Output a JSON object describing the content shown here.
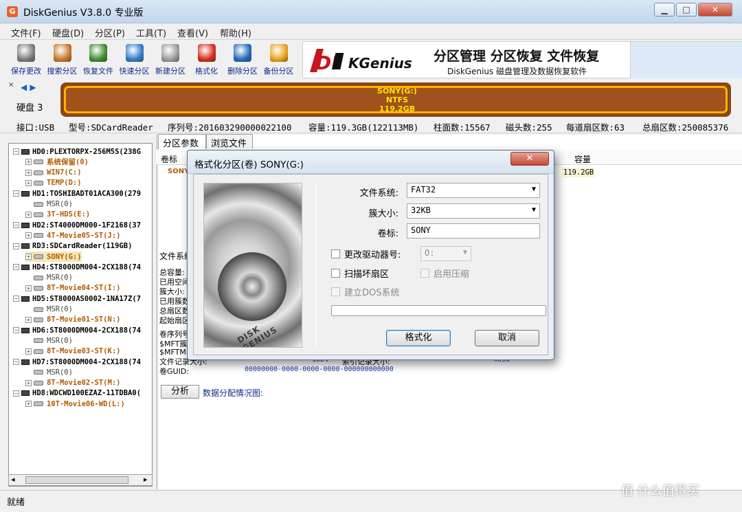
{
  "window": {
    "title": "DiskGenius V3.8.0 专业版",
    "app_icon_glyph": "G"
  },
  "menu": [
    "文件(F)",
    "硬盘(D)",
    "分区(P)",
    "工具(T)",
    "查看(V)",
    "帮助(H)"
  ],
  "toolbar": [
    {
      "label": "保存更改",
      "icon": "save-disk-icon",
      "color": "#7b7b7b"
    },
    {
      "label": "搜索分区",
      "icon": "magnifier-icon",
      "color": "#c9742c"
    },
    {
      "label": "恢复文件",
      "icon": "recover-box-icon",
      "color": "#3f8a2e"
    },
    {
      "label": "快速分区",
      "icon": "quick-partition-icon",
      "color": "#2f7cc8"
    },
    {
      "label": "新建分区",
      "icon": "new-partition-icon",
      "color": "#9a9a9a"
    },
    {
      "label": "格式化",
      "icon": "format-icon",
      "color": "#d42a1a"
    },
    {
      "label": "删除分区",
      "icon": "trash-icon",
      "color": "#1f69b8"
    },
    {
      "label": "备份分区",
      "icon": "backup-pie-icon",
      "color": "#e8a21a"
    }
  ],
  "banner": {
    "logo_text": "DISKGenius",
    "title": "分区管理 分区恢复 文件恢复",
    "subtitle": "DiskGenius 磁盘管理及数据恢复软件"
  },
  "disk_nav": {
    "label": "硬盘 3",
    "arrows": "◀ ▶",
    "pin": "×"
  },
  "disk_bar": {
    "name": "SONY(G:)",
    "fs": "NTFS",
    "size": "119.2GB"
  },
  "info_line": [
    "接口:USB",
    "型号:SDCardReader",
    "序列号:201603290000022100",
    "容量:119.3GB(122113MB)",
    "柱面数:15567",
    "磁头数:255",
    "每道扇区数:63",
    "总扇区数:250085376"
  ],
  "tree": [
    {
      "type": "disk",
      "text": "HD0:PLEXTORPX-256M5S(238G",
      "indent": 0,
      "exp": "−"
    },
    {
      "type": "part",
      "text": "系统保留(0)",
      "indent": 1,
      "exp": "+"
    },
    {
      "type": "part",
      "text": "WIN7(C:)",
      "indent": 1,
      "exp": "+"
    },
    {
      "type": "part",
      "text": "TEMP(D:)",
      "indent": 1,
      "exp": "+"
    },
    {
      "type": "disk",
      "text": "HD1:TOSHIBADT01ACA300(279",
      "indent": 0,
      "exp": "−"
    },
    {
      "type": "msr",
      "text": "MSR(0)",
      "indent": 1,
      "exp": ""
    },
    {
      "type": "part",
      "text": "3T-HDS(E:)",
      "indent": 1,
      "exp": "+"
    },
    {
      "type": "disk",
      "text": "HD2:ST4000DM000-1F2168(37",
      "indent": 0,
      "exp": "−"
    },
    {
      "type": "part",
      "text": "4T-Movie05-ST(J:)",
      "indent": 1,
      "exp": "+"
    },
    {
      "type": "disk",
      "text": "RD3:SDCardReader(119GB)",
      "indent": 0,
      "exp": "−"
    },
    {
      "type": "part",
      "text": "SONY(G:)",
      "indent": 1,
      "exp": "+",
      "selected": true
    },
    {
      "type": "disk",
      "text": "HD4:ST8000DM004-2CX188(74",
      "indent": 0,
      "exp": "−"
    },
    {
      "type": "msr",
      "text": "MSR(0)",
      "indent": 1,
      "exp": ""
    },
    {
      "type": "part",
      "text": "8T-Movie04-ST(I:)",
      "indent": 1,
      "exp": "+"
    },
    {
      "type": "disk",
      "text": "HD5:ST8000AS0002-1NA17Z(7",
      "indent": 0,
      "exp": "−"
    },
    {
      "type": "msr",
      "text": "MSR(0)",
      "indent": 1,
      "exp": ""
    },
    {
      "type": "part",
      "text": "8T-Movie01-ST(N:)",
      "indent": 1,
      "exp": "+"
    },
    {
      "type": "disk",
      "text": "HD6:ST8000DM004-2CX188(74",
      "indent": 0,
      "exp": "−"
    },
    {
      "type": "msr",
      "text": "MSR(0)",
      "indent": 1,
      "exp": ""
    },
    {
      "type": "part",
      "text": "8T-Movie03-ST(K:)",
      "indent": 1,
      "exp": "+"
    },
    {
      "type": "disk",
      "text": "HD7:ST8000DM004-2CX188(74",
      "indent": 0,
      "exp": "−"
    },
    {
      "type": "msr",
      "text": "MSR(0)",
      "indent": 1,
      "exp": ""
    },
    {
      "type": "part",
      "text": "8T-Movie02-ST(M:)",
      "indent": 1,
      "exp": "+"
    },
    {
      "type": "disk",
      "text": "HD8:WDCWD100EZAZ-11TDBA0(",
      "indent": 0,
      "exp": "−"
    },
    {
      "type": "part",
      "text": "10T-Movie06-WD(L:)",
      "indent": 1,
      "exp": "+"
    }
  ],
  "tree_scroll": {
    "left_arrow": "◂",
    "right_arrow": "▸"
  },
  "tabs": [
    "分区参数",
    "浏览文件"
  ],
  "partition_table": {
    "col_volume": "卷标",
    "col_capacity": "容量",
    "row_volume": "SONY(G:)",
    "row_capacity": "119.2GB"
  },
  "fs_details": {
    "header": "文件系统",
    "lines": [
      "总容量:",
      "已用空间",
      "簇大小:",
      "已用簇数",
      "总扇区数",
      "起始扇区",
      "卷序列号",
      "$MFT簇号",
      "$MFTMir",
      "文件记录大小:",
      "卷GUID:"
    ],
    "record_size_value": "1024",
    "index_record_label": "索引记录大小:",
    "index_record_value": "4096",
    "guid": "00000000-0000-0000-0000-000000000000"
  },
  "analyze": {
    "button": "分析",
    "caption": "数据分配情况图:"
  },
  "status": {
    "text": "就绪"
  },
  "watermark": "值 什么值得买",
  "dialog": {
    "title": "格式化分区(卷) SONY(G:)",
    "close": "✕",
    "image_brand": "DISK GENIUS",
    "filesystem_label": "文件系统:",
    "filesystem_value": "FAT32",
    "cluster_label": "簇大小:",
    "cluster_value": "32KB",
    "volume_label": "卷标:",
    "volume_value": "SONY",
    "change_drive_label": "更改驱动器号:",
    "drive_value": "O:",
    "scan_bad_label": "扫描坏扇区",
    "compress_label": "启用压缩",
    "dos_label": "建立DOS系统",
    "format_button": "格式化",
    "cancel_button": "取消",
    "dropdown_arrow": "▼"
  }
}
